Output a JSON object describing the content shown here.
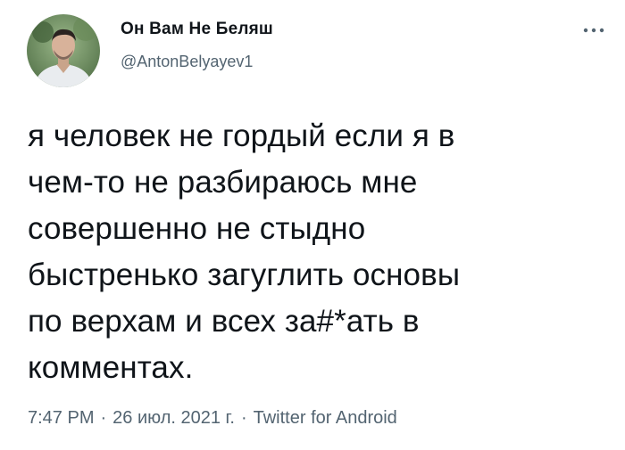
{
  "author": {
    "display_name": "Он Вам Не Беляш",
    "handle": "@AntonBelyayev1",
    "avatar_icon": "user-photo-avatar"
  },
  "more_menu_icon": "ellipsis-horizontal-icon",
  "tweet": {
    "lines": [
      "я человек не гордый если я в",
      "чем-то не разбираюсь мне",
      "совершенно не стыдно",
      "быстренько загуглить основы",
      "по верхам и всех за#*ать в",
      "комментах."
    ]
  },
  "meta": {
    "time": "7:47 PM",
    "separator": "·",
    "date": "26 июл. 2021 г.",
    "source": "Twitter for Android"
  },
  "colors": {
    "text_primary": "#0f1419",
    "text_secondary": "#536471",
    "background": "#ffffff"
  }
}
